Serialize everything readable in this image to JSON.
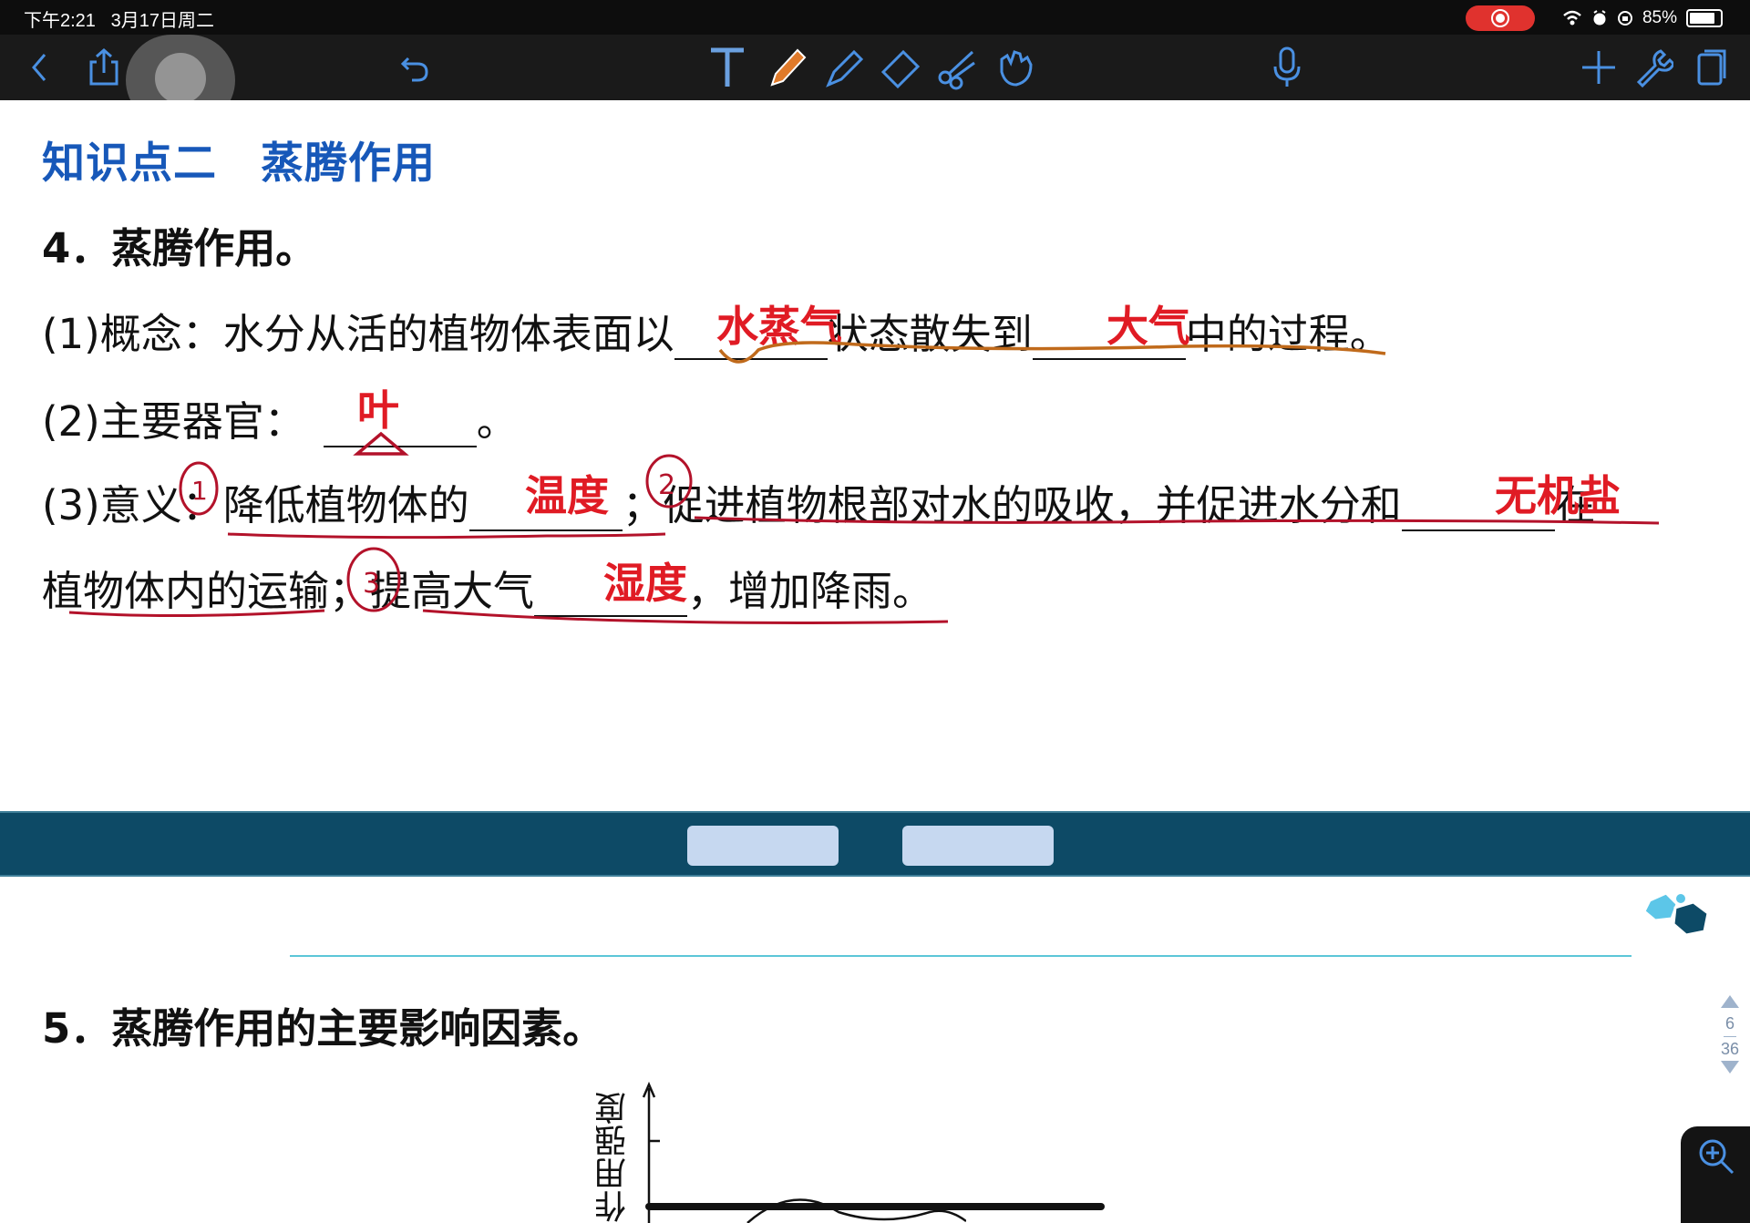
{
  "status": {
    "time": "下午2:21",
    "date": "3月17日周二",
    "battery": "85%",
    "battery_level": 0.85
  },
  "toolbar": {
    "icons": [
      "back-icon",
      "share-icon",
      "record-handle-icon",
      "undo-icon",
      "text-tool-icon",
      "pen-icon",
      "highlighter-icon",
      "eraser-icon",
      "scissors-icon",
      "hand-icon",
      "microphone-icon",
      "add-icon",
      "wrench-icon",
      "pages-icon"
    ]
  },
  "content": {
    "section_title": "知识点二　蒸腾作用",
    "q4_title": "4．蒸腾作用。",
    "q4_1_prefix": "(1)概念：水分从活的植物体表面以",
    "q4_1_mid": "状态散失到",
    "q4_1_suffix": "中的过程。",
    "ans_water_vapor": "水蒸气",
    "ans_atmosphere": "大气",
    "q4_2_prefix": "(2)主要器官：",
    "q4_2_suffix": "。",
    "ans_leaf": "叶",
    "q4_3_prefix": "(3)意义：",
    "q4_3_a": "降低植物体的",
    "ans_temperature": "温度",
    "q4_3_b": "；促进植物根部对水的吸收，并促进水分和",
    "ans_inorganic_salt": "无机盐",
    "q4_3_c": "在",
    "q4_3_line2_a": "植物体内的运输；提高大气",
    "ans_humidity": "湿度",
    "q4_3_line2_b": "，增加降雨。",
    "q5_title": "5．蒸腾作用的主要影响因素。",
    "chart_axis_label": "作用强度"
  },
  "pager": {
    "current": "6",
    "total": "36"
  },
  "colors": {
    "heading_blue": "#1758b9",
    "answer_red": "#e01b24",
    "band_teal": "#0d4a66",
    "ink_brown": "#c06a1b",
    "ink_crimson": "#b3122a"
  }
}
